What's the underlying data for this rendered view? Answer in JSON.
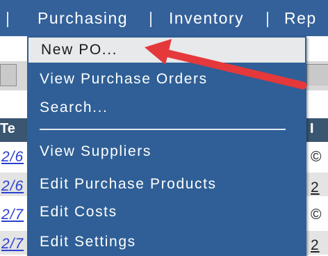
{
  "nav": {
    "items": [
      {
        "label": "|"
      },
      {
        "label": "Purchasing"
      },
      {
        "label": "|"
      },
      {
        "label": "Inventory"
      },
      {
        "label": "|"
      },
      {
        "label": "Rep"
      }
    ]
  },
  "background": {
    "header_left": "Te",
    "header_right": "I",
    "rows": [
      {
        "left": "2/6",
        "right": "©"
      },
      {
        "left": "2/6",
        "right": "2"
      },
      {
        "left": "2/7",
        "right": "©"
      },
      {
        "left": "2/7",
        "right": "2"
      }
    ]
  },
  "menu": {
    "items": [
      {
        "label": "New PO..."
      },
      {
        "label": "View Purchase Orders"
      },
      {
        "label": "Search..."
      },
      {
        "label": "View Suppliers"
      },
      {
        "label": "Edit Purchase Products"
      },
      {
        "label": "Edit Costs"
      },
      {
        "label": "Edit Settings"
      }
    ]
  },
  "colors": {
    "nav_bg": "#34619a",
    "menu_bg": "#2f5f96",
    "highlight_bg": "#e7e9ea",
    "arrow": "#e5383b"
  }
}
